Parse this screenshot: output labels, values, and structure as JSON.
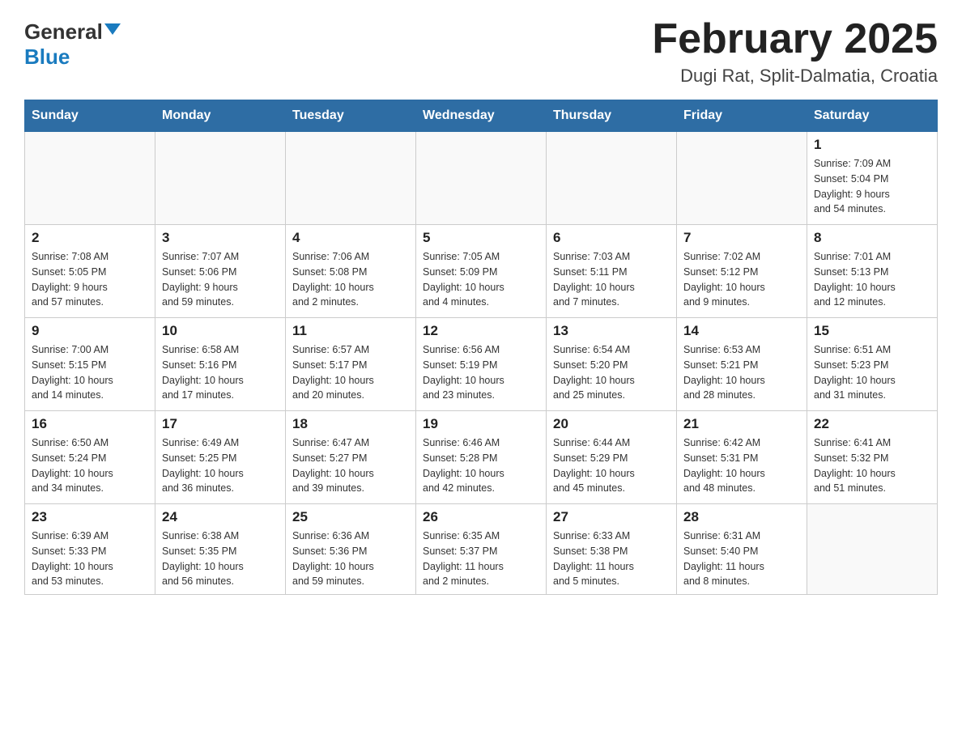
{
  "header": {
    "logo_general": "General",
    "logo_blue": "Blue",
    "month_title": "February 2025",
    "location": "Dugi Rat, Split-Dalmatia, Croatia"
  },
  "weekdays": [
    "Sunday",
    "Monday",
    "Tuesday",
    "Wednesday",
    "Thursday",
    "Friday",
    "Saturday"
  ],
  "weeks": [
    [
      {
        "day": "",
        "info": ""
      },
      {
        "day": "",
        "info": ""
      },
      {
        "day": "",
        "info": ""
      },
      {
        "day": "",
        "info": ""
      },
      {
        "day": "",
        "info": ""
      },
      {
        "day": "",
        "info": ""
      },
      {
        "day": "1",
        "info": "Sunrise: 7:09 AM\nSunset: 5:04 PM\nDaylight: 9 hours\nand 54 minutes."
      }
    ],
    [
      {
        "day": "2",
        "info": "Sunrise: 7:08 AM\nSunset: 5:05 PM\nDaylight: 9 hours\nand 57 minutes."
      },
      {
        "day": "3",
        "info": "Sunrise: 7:07 AM\nSunset: 5:06 PM\nDaylight: 9 hours\nand 59 minutes."
      },
      {
        "day": "4",
        "info": "Sunrise: 7:06 AM\nSunset: 5:08 PM\nDaylight: 10 hours\nand 2 minutes."
      },
      {
        "day": "5",
        "info": "Sunrise: 7:05 AM\nSunset: 5:09 PM\nDaylight: 10 hours\nand 4 minutes."
      },
      {
        "day": "6",
        "info": "Sunrise: 7:03 AM\nSunset: 5:11 PM\nDaylight: 10 hours\nand 7 minutes."
      },
      {
        "day": "7",
        "info": "Sunrise: 7:02 AM\nSunset: 5:12 PM\nDaylight: 10 hours\nand 9 minutes."
      },
      {
        "day": "8",
        "info": "Sunrise: 7:01 AM\nSunset: 5:13 PM\nDaylight: 10 hours\nand 12 minutes."
      }
    ],
    [
      {
        "day": "9",
        "info": "Sunrise: 7:00 AM\nSunset: 5:15 PM\nDaylight: 10 hours\nand 14 minutes."
      },
      {
        "day": "10",
        "info": "Sunrise: 6:58 AM\nSunset: 5:16 PM\nDaylight: 10 hours\nand 17 minutes."
      },
      {
        "day": "11",
        "info": "Sunrise: 6:57 AM\nSunset: 5:17 PM\nDaylight: 10 hours\nand 20 minutes."
      },
      {
        "day": "12",
        "info": "Sunrise: 6:56 AM\nSunset: 5:19 PM\nDaylight: 10 hours\nand 23 minutes."
      },
      {
        "day": "13",
        "info": "Sunrise: 6:54 AM\nSunset: 5:20 PM\nDaylight: 10 hours\nand 25 minutes."
      },
      {
        "day": "14",
        "info": "Sunrise: 6:53 AM\nSunset: 5:21 PM\nDaylight: 10 hours\nand 28 minutes."
      },
      {
        "day": "15",
        "info": "Sunrise: 6:51 AM\nSunset: 5:23 PM\nDaylight: 10 hours\nand 31 minutes."
      }
    ],
    [
      {
        "day": "16",
        "info": "Sunrise: 6:50 AM\nSunset: 5:24 PM\nDaylight: 10 hours\nand 34 minutes."
      },
      {
        "day": "17",
        "info": "Sunrise: 6:49 AM\nSunset: 5:25 PM\nDaylight: 10 hours\nand 36 minutes."
      },
      {
        "day": "18",
        "info": "Sunrise: 6:47 AM\nSunset: 5:27 PM\nDaylight: 10 hours\nand 39 minutes."
      },
      {
        "day": "19",
        "info": "Sunrise: 6:46 AM\nSunset: 5:28 PM\nDaylight: 10 hours\nand 42 minutes."
      },
      {
        "day": "20",
        "info": "Sunrise: 6:44 AM\nSunset: 5:29 PM\nDaylight: 10 hours\nand 45 minutes."
      },
      {
        "day": "21",
        "info": "Sunrise: 6:42 AM\nSunset: 5:31 PM\nDaylight: 10 hours\nand 48 minutes."
      },
      {
        "day": "22",
        "info": "Sunrise: 6:41 AM\nSunset: 5:32 PM\nDaylight: 10 hours\nand 51 minutes."
      }
    ],
    [
      {
        "day": "23",
        "info": "Sunrise: 6:39 AM\nSunset: 5:33 PM\nDaylight: 10 hours\nand 53 minutes."
      },
      {
        "day": "24",
        "info": "Sunrise: 6:38 AM\nSunset: 5:35 PM\nDaylight: 10 hours\nand 56 minutes."
      },
      {
        "day": "25",
        "info": "Sunrise: 6:36 AM\nSunset: 5:36 PM\nDaylight: 10 hours\nand 59 minutes."
      },
      {
        "day": "26",
        "info": "Sunrise: 6:35 AM\nSunset: 5:37 PM\nDaylight: 11 hours\nand 2 minutes."
      },
      {
        "day": "27",
        "info": "Sunrise: 6:33 AM\nSunset: 5:38 PM\nDaylight: 11 hours\nand 5 minutes."
      },
      {
        "day": "28",
        "info": "Sunrise: 6:31 AM\nSunset: 5:40 PM\nDaylight: 11 hours\nand 8 minutes."
      },
      {
        "day": "",
        "info": ""
      }
    ]
  ]
}
